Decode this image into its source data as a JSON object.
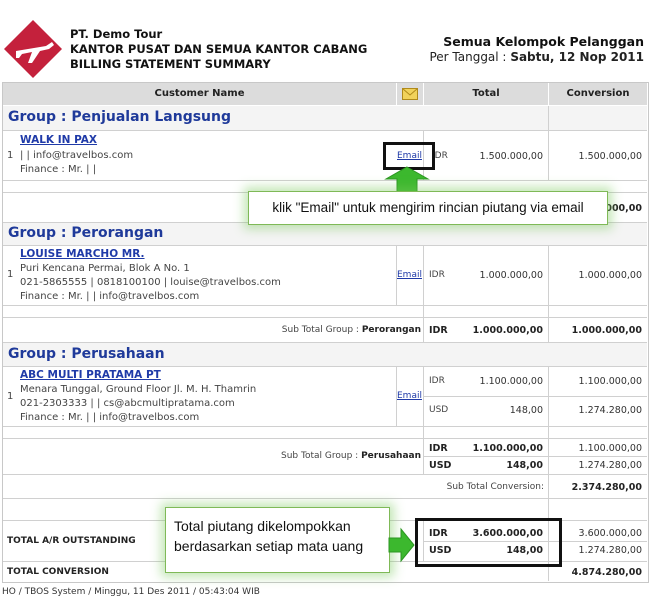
{
  "header": {
    "company": "PT. Demo Tour",
    "subtitle": "KANTOR PUSAT DAN SEMUA KANTOR CABANG",
    "report_title": "BILLING STATEMENT SUMMARY",
    "group_filter": "Semua Kelompok Pelanggan",
    "date_label": "Per Tanggal :",
    "date_value": "Sabtu, 12 Nop 2011"
  },
  "table": {
    "col_customer": "Customer Name",
    "col_total": "Total",
    "col_conversion": "Conversion"
  },
  "groups": [
    {
      "title": "Group : Penjualan Langsung",
      "row_no": "1",
      "customer": "WALK IN PAX",
      "lines": [
        "| | info@travelbos.com",
        "Finance : Mr. | |"
      ],
      "email": "Email",
      "amounts": [
        {
          "currency": "IDR",
          "total": "1.500.000,00",
          "conversion": "1.500.000,00"
        }
      ],
      "subtotal_conversion": "1.500.000,00"
    },
    {
      "title": "Group : Perorangan",
      "row_no": "1",
      "customer": "LOUISE MARCHO MR.",
      "lines": [
        "Puri Kencana Permai, Blok A No. 1",
        "021-5865555 | 0818100100 | louise@travelbos.com",
        "Finance : Mr. | | info@travelbos.com"
      ],
      "email": "Email",
      "amounts": [
        {
          "currency": "IDR",
          "total": "1.000.000,00",
          "conversion": "1.000.000,00"
        }
      ],
      "subtotal_label": "Sub Total Group :",
      "subtotal_name": "Perorangan",
      "subtotals": [
        {
          "currency": "IDR",
          "total": "1.000.000,00",
          "conversion": "1.000.000,00"
        }
      ]
    },
    {
      "title": "Group : Perusahaan",
      "row_no": "1",
      "customer": "ABC MULTI PRATAMA PT",
      "lines": [
        "Menara Tunggal, Ground Floor Jl. M. H. Thamrin",
        "021-2303333 | | cs@abcmultipratama.com",
        "Finance : Mr. | | info@travelbos.com"
      ],
      "email": "Email",
      "amounts": [
        {
          "currency": "IDR",
          "total": "1.100.000,00",
          "conversion": "1.100.000,00"
        },
        {
          "currency": "USD",
          "total": "148,00",
          "conversion": "1.274.280,00"
        }
      ],
      "subtotal_label": "Sub Total Group :",
      "subtotal_name": "Perusahaan",
      "subtotals": [
        {
          "currency": "IDR",
          "total": "1.100.000,00",
          "conversion": "1.100.000,00"
        },
        {
          "currency": "USD",
          "total": "148,00",
          "conversion": "1.274.280,00"
        }
      ],
      "subtotal_conversion_label": "Sub Total Conversion:",
      "subtotal_conversion": "2.374.280,00"
    }
  ],
  "totals": {
    "ar_label": "TOTAL A/R OUTSTANDING",
    "ar": [
      {
        "currency": "IDR",
        "total": "3.600.000,00",
        "conversion": "3.600.000,00"
      },
      {
        "currency": "USD",
        "total": "148,00",
        "conversion": "1.274.280,00"
      }
    ],
    "conversion_label": "TOTAL CONVERSION",
    "conversion_value": "4.874.280,00"
  },
  "footer": "HO / TBOS System / Minggu, 11 Des 2011 / 05:43:04 WIB",
  "callouts": {
    "email_tip": "klik \"Email\" untuk mengirim rincian piutang via email",
    "currency_tip": "Total piutang dikelompokkan berdasarkan setiap mata uang"
  },
  "colors": {
    "accent": "#1f3a9a",
    "logo": "#c4213c",
    "callout_green": "#3cb82e"
  }
}
